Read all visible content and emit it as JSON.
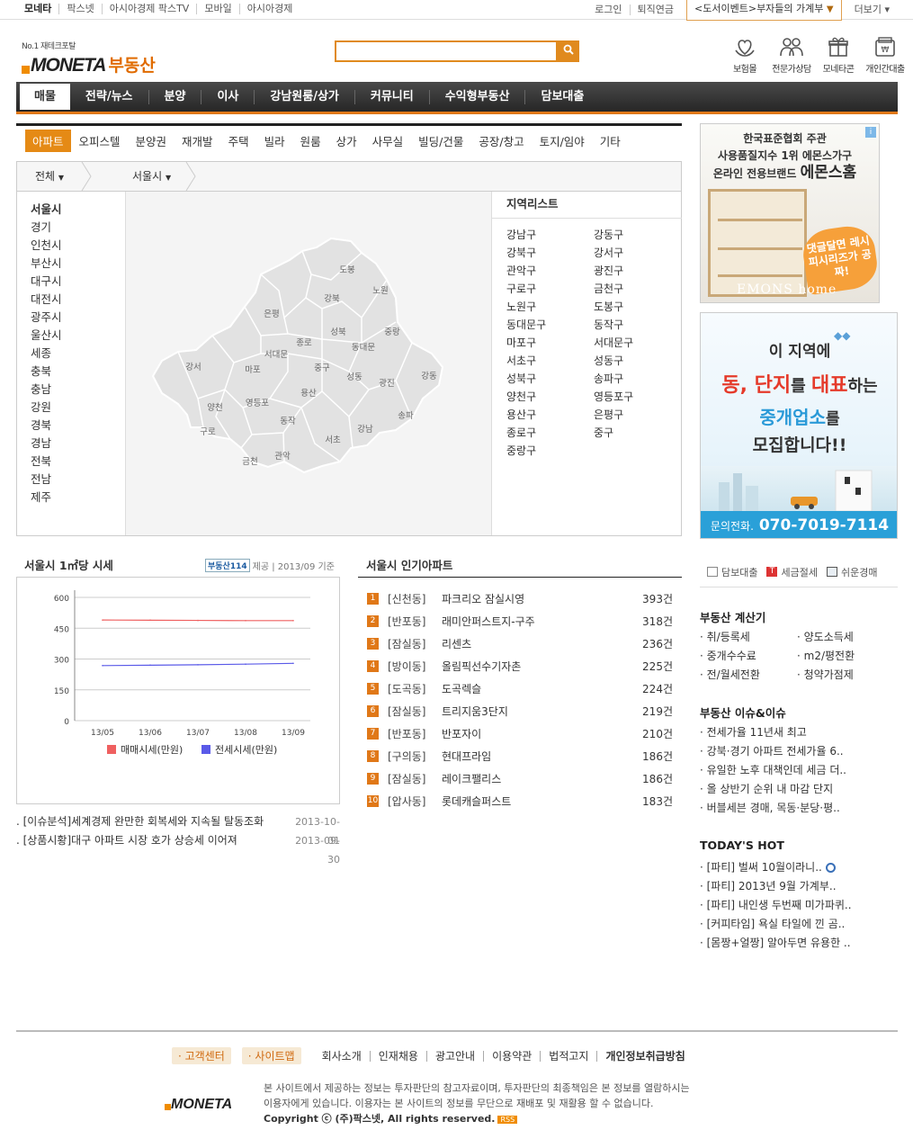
{
  "topbar": {
    "sites": [
      "모네타",
      "팍스넷",
      "아시아경제 팍스TV",
      "모바일",
      "아시아경제"
    ],
    "links": [
      "로그인",
      "퇴직연금"
    ],
    "event": "<도서이벤트>부자들의 가계부",
    "more": "더보기 ▾"
  },
  "header": {
    "tagline": "No.1 재테크포탈",
    "brand": "MONETA",
    "brand_sub": "부동산",
    "quick": [
      {
        "icon": "heart-hands-icon",
        "label": "보험몰"
      },
      {
        "icon": "consultants-icon",
        "label": "전문가상담"
      },
      {
        "icon": "gift-icon",
        "label": "모네타콘"
      },
      {
        "icon": "loan-icon",
        "label": "개인간대출"
      }
    ]
  },
  "gnb": [
    "매물",
    "전략/뉴스",
    "분양",
    "이사",
    "강남원룸/상가",
    "커뮤니티",
    "수익형부동산",
    "담보대출"
  ],
  "subtabs": [
    "아파트",
    "오피스텔",
    "분양권",
    "재개발",
    "주택",
    "빌라",
    "원룸",
    "상가",
    "사무실",
    "빌딩/건물",
    "공장/창고",
    "토지/임야",
    "기타"
  ],
  "crumb": {
    "level1": "전체",
    "level2": "서울시"
  },
  "cities": [
    "서울시",
    "경기",
    "인천시",
    "부산시",
    "대구시",
    "대전시",
    "광주시",
    "울산시",
    "세종",
    "충북",
    "충남",
    "강원",
    "경북",
    "경남",
    "전북",
    "전남",
    "제주"
  ],
  "map_labels": [
    "도봉",
    "노원",
    "강북",
    "은평",
    "성북",
    "중랑",
    "종로",
    "동대문",
    "서대문",
    "강서",
    "마포",
    "중구",
    "성동",
    "광진",
    "강동",
    "용산",
    "양천",
    "영등포",
    "동작",
    "송파",
    "구로",
    "강남",
    "서초",
    "관악",
    "금천"
  ],
  "district_list": {
    "title": "지역리스트",
    "items": [
      "강남구",
      "강동구",
      "강북구",
      "강서구",
      "관악구",
      "광진구",
      "구로구",
      "금천구",
      "노원구",
      "도봉구",
      "동대문구",
      "동작구",
      "마포구",
      "서대문구",
      "서초구",
      "성동구",
      "성북구",
      "송파구",
      "양천구",
      "영등포구",
      "용산구",
      "은평구",
      "종로구",
      "중구",
      "중랑구"
    ]
  },
  "price": {
    "title": "서울시 1㎡당 시세",
    "source_badge": "부동산114",
    "source_text": "제공 | 2013/09 기준"
  },
  "chart_data": {
    "type": "line",
    "x": [
      "13/05",
      "13/06",
      "13/07",
      "13/08",
      "13/09"
    ],
    "ylim": [
      0,
      600
    ],
    "yticks": [
      "600",
      "450",
      "300",
      "150",
      "0"
    ],
    "series": [
      {
        "name": "매매시세(만원)",
        "color": "#ef6060",
        "values": [
          490,
          489,
          488,
          487,
          487
        ]
      },
      {
        "name": "전세시세(만원)",
        "color": "#5a5ae8",
        "values": [
          268,
          270,
          272,
          275,
          279
        ]
      }
    ]
  },
  "popular": {
    "title": "서울시 인기아파트",
    "rows": [
      {
        "num": "1",
        "dong": "[신천동]",
        "name": "파크리오 잠실시영",
        "count": "393건"
      },
      {
        "num": "2",
        "dong": "[반포동]",
        "name": "래미안퍼스트지-구주",
        "count": "318건"
      },
      {
        "num": "3",
        "dong": "[잠실동]",
        "name": "리센츠",
        "count": "236건"
      },
      {
        "num": "4",
        "dong": "[방이동]",
        "name": "올림픽선수기자촌",
        "count": "225건"
      },
      {
        "num": "5",
        "dong": "[도곡동]",
        "name": "도곡렉슬",
        "count": "224건"
      },
      {
        "num": "6",
        "dong": "[잠실동]",
        "name": "트리지움3단지",
        "count": "219건"
      },
      {
        "num": "7",
        "dong": "[반포동]",
        "name": "반포자이",
        "count": "210건"
      },
      {
        "num": "8",
        "dong": "[구의동]",
        "name": "현대프라임",
        "count": "186건"
      },
      {
        "num": "9",
        "dong": "[잠실동]",
        "name": "레이크팰리스",
        "count": "186건"
      },
      {
        "num": "10",
        "dong": "[압사동]",
        "name": "롯데캐슬퍼스트",
        "count": "183건"
      }
    ]
  },
  "news": [
    {
      "title": ". [이슈분석]세계경제 완만한 회복세와 지속될 탈동조화",
      "date": "2013-10-01"
    },
    {
      "title": ". [상품시황]대구 아파트 시장 호가 상승세 이어져",
      "date": "2013-09-30"
    }
  ],
  "ad1": {
    "line1": "한국표준협회 주관",
    "line2": "사용품질지수 1위 에몬스가구",
    "line3": "온라인 전용브랜드",
    "line4": "에몬스홈",
    "bubble": "댓글달면 레시피시리즈가 공짜!",
    "brand": "EMONS home",
    "info": "i"
  },
  "ad2": {
    "line1": "이 지역에",
    "line2a": "동, 단지",
    "line2b": "를 ",
    "line2c": "대표",
    "line2d": "하는",
    "line3a": "중개업소",
    "line3b": "를",
    "line4": "모집합니다!!",
    "phone_label": "문의전화.",
    "phone": "070-7019-7114"
  },
  "shortcuts": [
    "담보대출",
    "세금절세",
    "쉬운경매"
  ],
  "calc": {
    "title": "부동산 계산기",
    "items": [
      "· 취/등록세",
      "· 양도소득세",
      "· 중개수수료",
      "· m2/평전환",
      "· 전/월세전환",
      "· 청약가점제"
    ]
  },
  "issue": {
    "title": "부동산 이슈&이슈",
    "items": [
      "· 전세가율 11년새 최고",
      "· 강북·경기 아파트 전세가율 6..",
      "· 유일한 노후 대책인데 세금 더..",
      "· 올 상반기 순위 내 마감 단지",
      "· 버블세븐 경매, 목동·분당·평.."
    ]
  },
  "hot": {
    "title": "TODAY'S HOT",
    "items": [
      "· [파티] 벌써 10월이라니..",
      "· [파티] 2013년 9월 가계부..",
      "· [파티] 내인생 두번째 미가파퀴..",
      "· [커피타임] 욕실 타일에 낀 곰..",
      "· [몸짱+얼짱] 알아두면 유용한 .."
    ]
  },
  "footer": {
    "pills": [
      "· 고객센터",
      "· 사이트맵"
    ],
    "links": [
      "회사소개",
      "인재채용",
      "광고안내",
      "이용약관",
      "법적고지",
      "개인정보취급방침"
    ],
    "logo": "MONETA",
    "text1": "본 사이트에서 제공하는 정보는 투자판단의 참고자료이며, 투자판단의 최종책임은 본 정보를 열람하시는",
    "text2": "이용자에게 있습니다. 이용자는 본 사이트의 정보를 무단으로 재배포 및 재활용 할 수 없습니다.",
    "copyright": "Copyright ⓒ (주)팍스넷, All rights reserved.",
    "rss": "RSS"
  }
}
